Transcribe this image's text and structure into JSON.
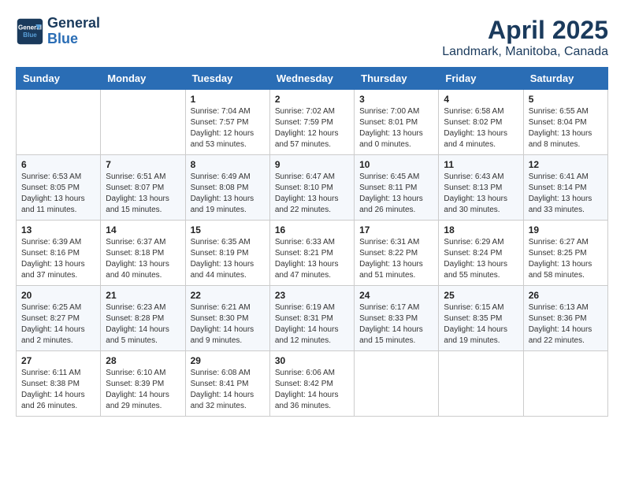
{
  "header": {
    "logo_line1": "General",
    "logo_line2": "Blue",
    "title": "April 2025",
    "subtitle": "Landmark, Manitoba, Canada"
  },
  "days_of_week": [
    "Sunday",
    "Monday",
    "Tuesday",
    "Wednesday",
    "Thursday",
    "Friday",
    "Saturday"
  ],
  "weeks": [
    [
      {
        "day": "",
        "info": ""
      },
      {
        "day": "",
        "info": ""
      },
      {
        "day": "1",
        "info": "Sunrise: 7:04 AM\nSunset: 7:57 PM\nDaylight: 12 hours\nand 53 minutes."
      },
      {
        "day": "2",
        "info": "Sunrise: 7:02 AM\nSunset: 7:59 PM\nDaylight: 12 hours\nand 57 minutes."
      },
      {
        "day": "3",
        "info": "Sunrise: 7:00 AM\nSunset: 8:01 PM\nDaylight: 13 hours\nand 0 minutes."
      },
      {
        "day": "4",
        "info": "Sunrise: 6:58 AM\nSunset: 8:02 PM\nDaylight: 13 hours\nand 4 minutes."
      },
      {
        "day": "5",
        "info": "Sunrise: 6:55 AM\nSunset: 8:04 PM\nDaylight: 13 hours\nand 8 minutes."
      }
    ],
    [
      {
        "day": "6",
        "info": "Sunrise: 6:53 AM\nSunset: 8:05 PM\nDaylight: 13 hours\nand 11 minutes."
      },
      {
        "day": "7",
        "info": "Sunrise: 6:51 AM\nSunset: 8:07 PM\nDaylight: 13 hours\nand 15 minutes."
      },
      {
        "day": "8",
        "info": "Sunrise: 6:49 AM\nSunset: 8:08 PM\nDaylight: 13 hours\nand 19 minutes."
      },
      {
        "day": "9",
        "info": "Sunrise: 6:47 AM\nSunset: 8:10 PM\nDaylight: 13 hours\nand 22 minutes."
      },
      {
        "day": "10",
        "info": "Sunrise: 6:45 AM\nSunset: 8:11 PM\nDaylight: 13 hours\nand 26 minutes."
      },
      {
        "day": "11",
        "info": "Sunrise: 6:43 AM\nSunset: 8:13 PM\nDaylight: 13 hours\nand 30 minutes."
      },
      {
        "day": "12",
        "info": "Sunrise: 6:41 AM\nSunset: 8:14 PM\nDaylight: 13 hours\nand 33 minutes."
      }
    ],
    [
      {
        "day": "13",
        "info": "Sunrise: 6:39 AM\nSunset: 8:16 PM\nDaylight: 13 hours\nand 37 minutes."
      },
      {
        "day": "14",
        "info": "Sunrise: 6:37 AM\nSunset: 8:18 PM\nDaylight: 13 hours\nand 40 minutes."
      },
      {
        "day": "15",
        "info": "Sunrise: 6:35 AM\nSunset: 8:19 PM\nDaylight: 13 hours\nand 44 minutes."
      },
      {
        "day": "16",
        "info": "Sunrise: 6:33 AM\nSunset: 8:21 PM\nDaylight: 13 hours\nand 47 minutes."
      },
      {
        "day": "17",
        "info": "Sunrise: 6:31 AM\nSunset: 8:22 PM\nDaylight: 13 hours\nand 51 minutes."
      },
      {
        "day": "18",
        "info": "Sunrise: 6:29 AM\nSunset: 8:24 PM\nDaylight: 13 hours\nand 55 minutes."
      },
      {
        "day": "19",
        "info": "Sunrise: 6:27 AM\nSunset: 8:25 PM\nDaylight: 13 hours\nand 58 minutes."
      }
    ],
    [
      {
        "day": "20",
        "info": "Sunrise: 6:25 AM\nSunset: 8:27 PM\nDaylight: 14 hours\nand 2 minutes."
      },
      {
        "day": "21",
        "info": "Sunrise: 6:23 AM\nSunset: 8:28 PM\nDaylight: 14 hours\nand 5 minutes."
      },
      {
        "day": "22",
        "info": "Sunrise: 6:21 AM\nSunset: 8:30 PM\nDaylight: 14 hours\nand 9 minutes."
      },
      {
        "day": "23",
        "info": "Sunrise: 6:19 AM\nSunset: 8:31 PM\nDaylight: 14 hours\nand 12 minutes."
      },
      {
        "day": "24",
        "info": "Sunrise: 6:17 AM\nSunset: 8:33 PM\nDaylight: 14 hours\nand 15 minutes."
      },
      {
        "day": "25",
        "info": "Sunrise: 6:15 AM\nSunset: 8:35 PM\nDaylight: 14 hours\nand 19 minutes."
      },
      {
        "day": "26",
        "info": "Sunrise: 6:13 AM\nSunset: 8:36 PM\nDaylight: 14 hours\nand 22 minutes."
      }
    ],
    [
      {
        "day": "27",
        "info": "Sunrise: 6:11 AM\nSunset: 8:38 PM\nDaylight: 14 hours\nand 26 minutes."
      },
      {
        "day": "28",
        "info": "Sunrise: 6:10 AM\nSunset: 8:39 PM\nDaylight: 14 hours\nand 29 minutes."
      },
      {
        "day": "29",
        "info": "Sunrise: 6:08 AM\nSunset: 8:41 PM\nDaylight: 14 hours\nand 32 minutes."
      },
      {
        "day": "30",
        "info": "Sunrise: 6:06 AM\nSunset: 8:42 PM\nDaylight: 14 hours\nand 36 minutes."
      },
      {
        "day": "",
        "info": ""
      },
      {
        "day": "",
        "info": ""
      },
      {
        "day": "",
        "info": ""
      }
    ]
  ]
}
